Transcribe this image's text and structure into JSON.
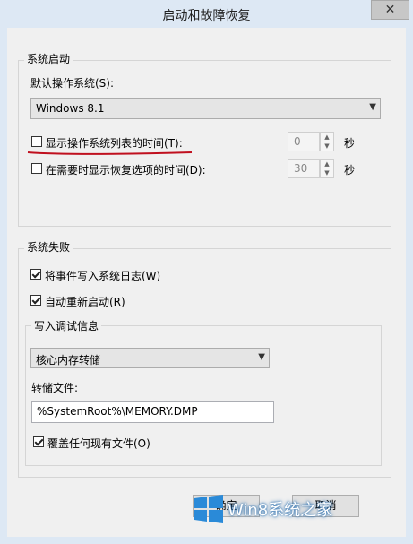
{
  "window": {
    "title": "启动和故障恢复",
    "close_label": "✕"
  },
  "startup": {
    "group_label": "系统启动",
    "default_os_label": "默认操作系统(S):",
    "default_os_value": "Windows 8.1",
    "show_os_list": {
      "label": "显示操作系统列表的时间(T):",
      "checked": false,
      "value": "0",
      "unit": "秒"
    },
    "show_recovery": {
      "label": "在需要时显示恢复选项的时间(D):",
      "checked": false,
      "value": "30",
      "unit": "秒"
    }
  },
  "failure": {
    "group_label": "系统失败",
    "write_event": {
      "label": "将事件写入系统日志(W)",
      "checked": true
    },
    "auto_restart": {
      "label": "自动重新启动(R)",
      "checked": true
    },
    "debug": {
      "group_label": "写入调试信息",
      "type_value": "核心内存转储",
      "dump_file_label": "转储文件:",
      "dump_file_value": "%SystemRoot%\\MEMORY.DMP",
      "overwrite": {
        "label": "覆盖任何现有文件(O)",
        "checked": true
      }
    }
  },
  "buttons": {
    "ok_label": "确定",
    "cancel_label": "取消"
  },
  "watermark": {
    "text": "Win8系统之家"
  },
  "colors": {
    "annotation_red": "#c0101f",
    "watermark_blue": "#2a6fb0"
  }
}
